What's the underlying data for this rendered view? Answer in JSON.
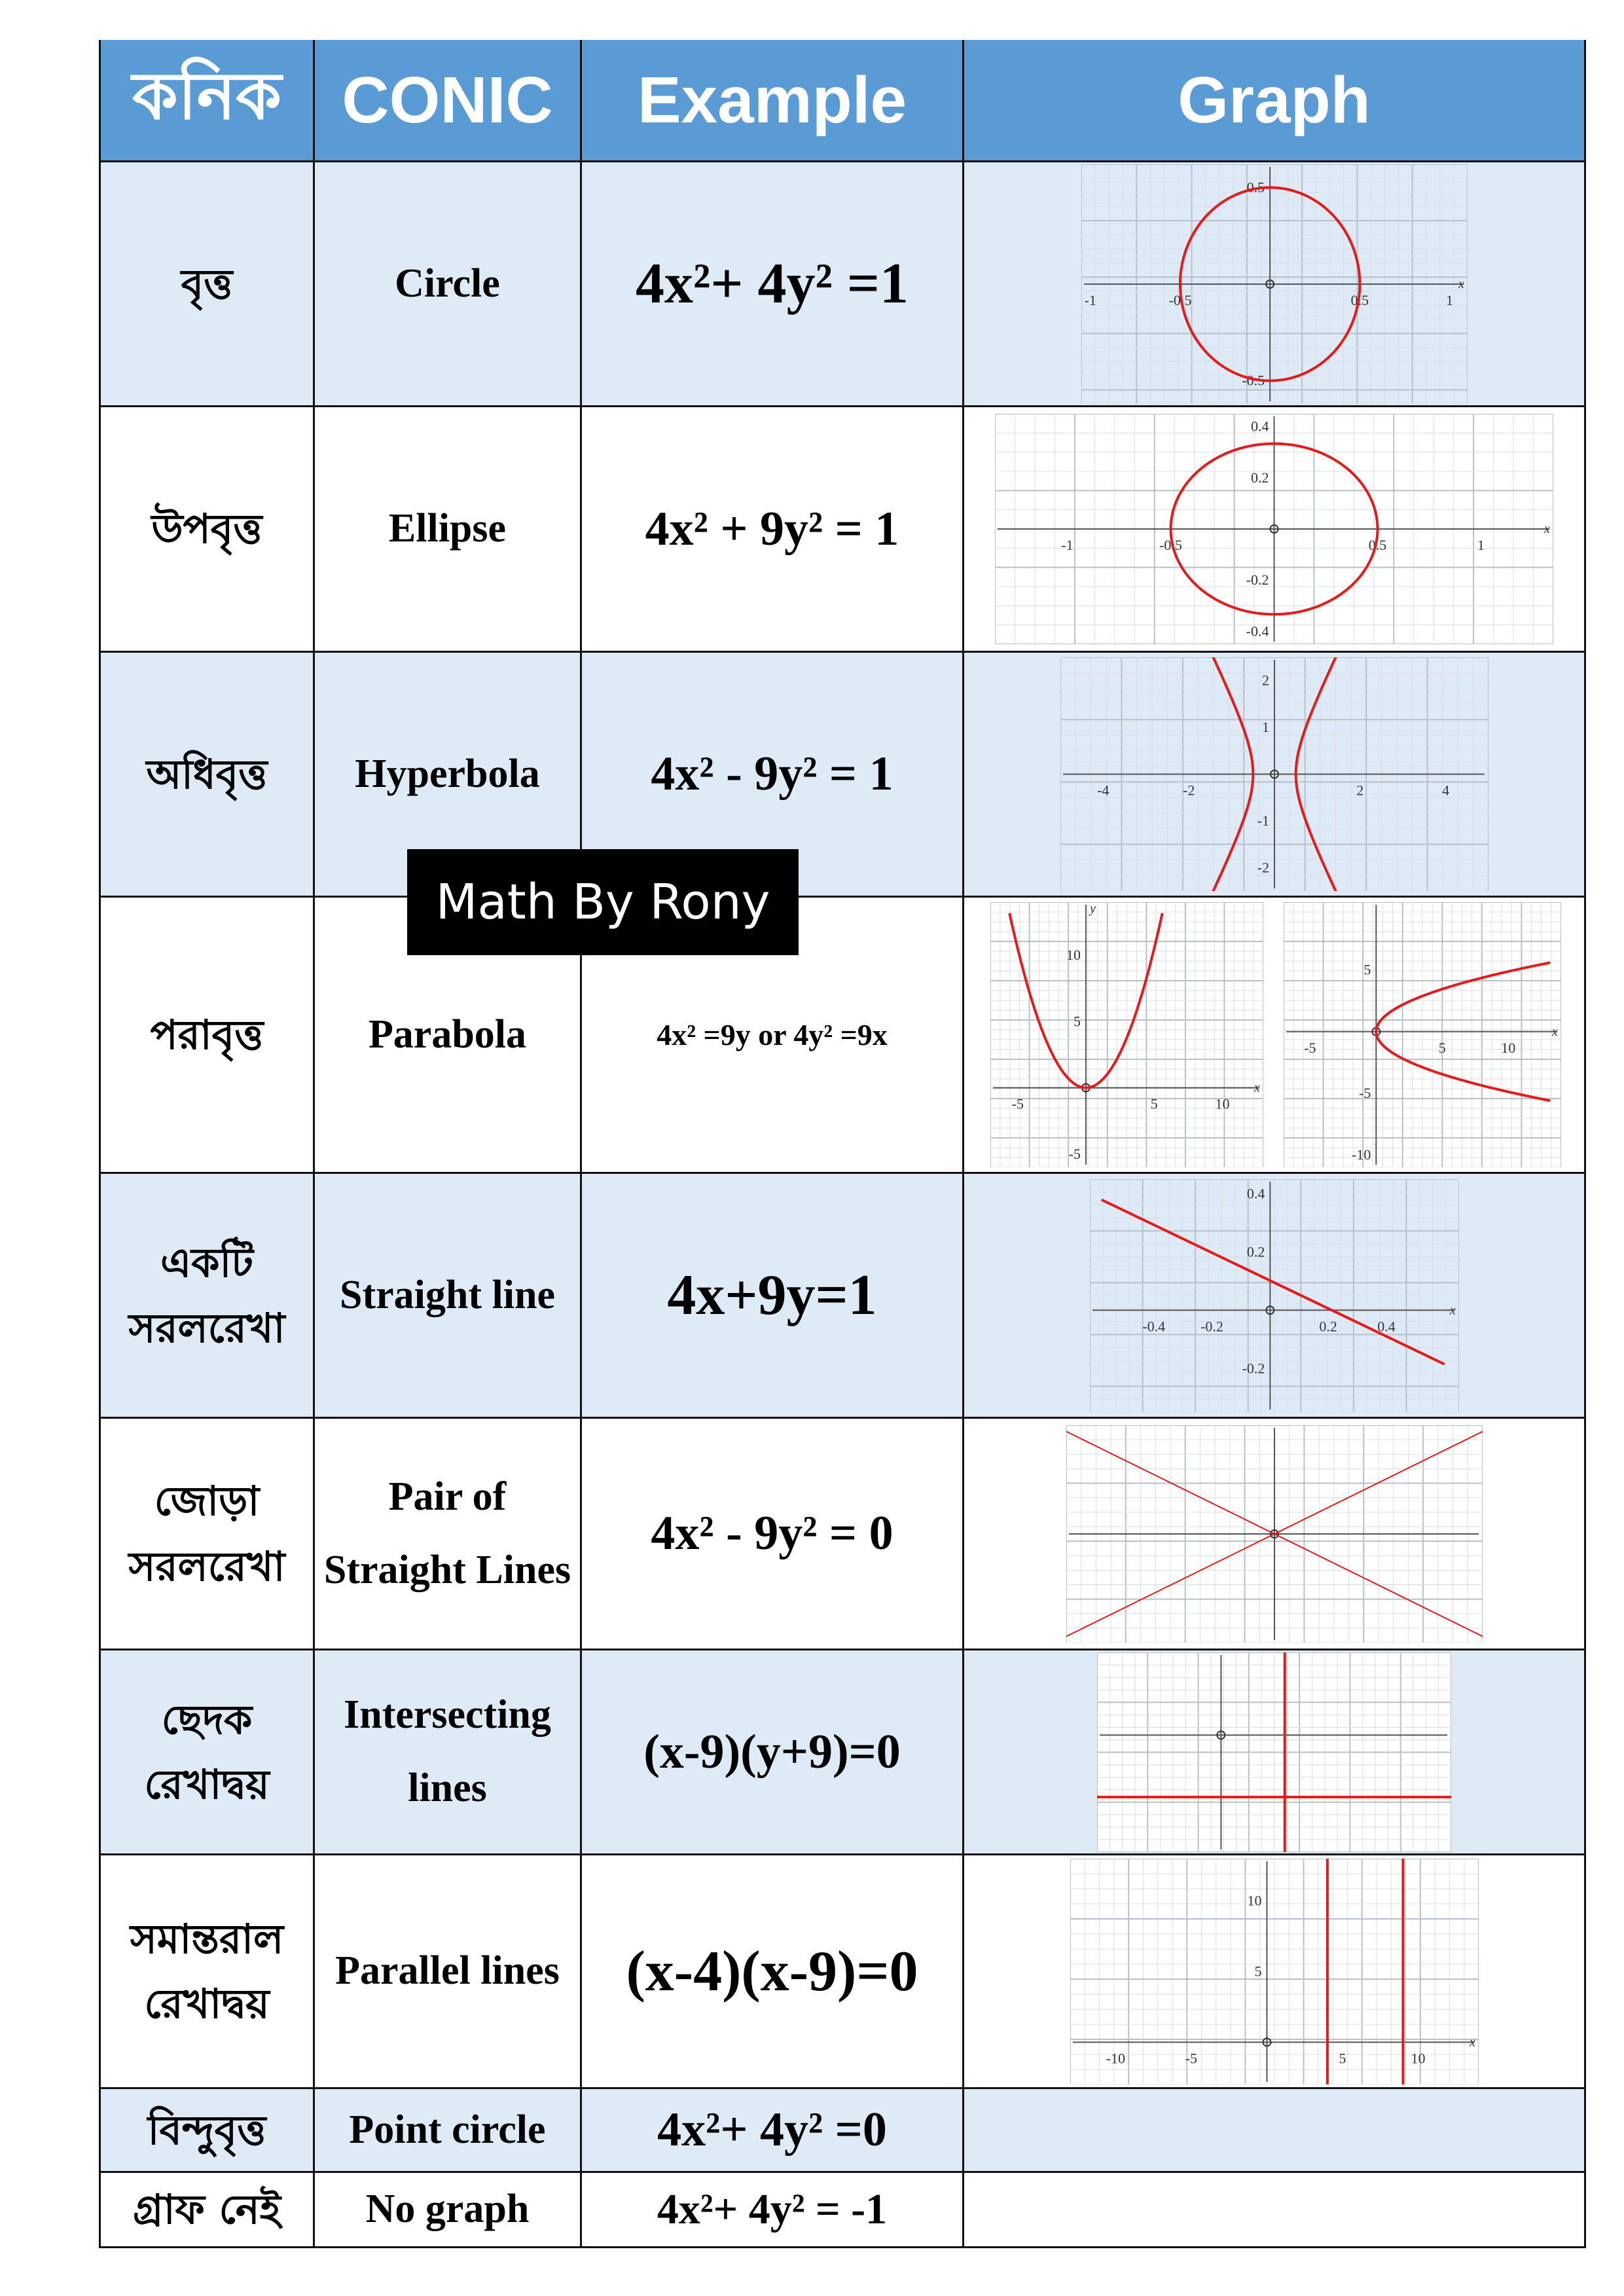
{
  "header": {
    "bengali": "কনিক",
    "conic": "CONIC",
    "example": "Example",
    "graph": "Graph",
    "color": "#5b9bd5"
  },
  "curve_color": "#e31b1b",
  "rows": [
    {
      "bengali": "বৃত্ত",
      "conic": "Circle",
      "equation": "4x²+ 4y² =1",
      "graph": {
        "kind": "circle",
        "xlim": [
          -1.05,
          1.1
        ],
        "ylim": [
          -0.62,
          0.62
        ],
        "xticks": [
          "-1",
          "-0.5",
          "0.5",
          "1"
        ],
        "yticks": [
          "0.5",
          "-0.5"
        ],
        "xlabel": "x"
      }
    },
    {
      "bengali": "উপবৃত্ত",
      "conic": "Ellipse",
      "equation": "4x² + 9y² = 1",
      "graph": {
        "kind": "ellipse",
        "xlim": [
          -1.35,
          1.35
        ],
        "ylim": [
          -0.45,
          0.45
        ],
        "xticks": [
          "-1",
          "-0.5",
          "0.5",
          "1"
        ],
        "yticks": [
          "0.4",
          "0.2",
          "-0.2",
          "-0.4"
        ],
        "xlabel": "x"
      }
    },
    {
      "bengali": "অধিবৃত্ত",
      "conic": "Hyperbola",
      "equation": "4x² - 9y² = 1",
      "graph": {
        "kind": "hyperbola",
        "xlim": [
          -5,
          5
        ],
        "ylim": [
          -2.5,
          2.5
        ],
        "xticks": [
          "-4",
          "-2",
          "2",
          "4"
        ],
        "yticks": [
          "2",
          "1",
          "-1",
          "-2"
        ],
        "xlabel": ""
      }
    },
    {
      "bengali": "পরাবৃত্ত",
      "conic": "Parabola",
      "equation": "4x² =9y  or  4y² =9x",
      "graph": {
        "kind": "parabola-up",
        "xlim": [
          -7,
          13
        ],
        "ylim": [
          -6,
          14
        ],
        "xticks": [
          "-5",
          "5",
          "10"
        ],
        "yticks": [
          "10",
          "5",
          "-5"
        ],
        "xlabel": "x",
        "ylabel": "y"
      },
      "graph2": {
        "kind": "parabola-right",
        "xlim": [
          -7,
          14
        ],
        "ylim": [
          -11,
          10.5
        ],
        "xticks": [
          "-5",
          "5",
          "10"
        ],
        "yticks": [
          "5",
          "-5",
          "-10"
        ],
        "xlabel": "x"
      }
    },
    {
      "bengali": "একটি সরলরেখা",
      "conic": "Straight line",
      "equation": "4x+9y=1",
      "graph": {
        "kind": "line",
        "xlim": [
          -0.62,
          0.65
        ],
        "ylim": [
          -0.35,
          0.45
        ],
        "xticks": [
          "-0.4",
          "-0.2",
          "0.2",
          "0.4"
        ],
        "yticks": [
          "0.4",
          "0.2",
          "-0.2"
        ],
        "xlabel": "x"
      }
    },
    {
      "bengali": "জোড়া সরলরেখা",
      "conic": "Pair of Straight Lines",
      "equation": "4x² - 9y² = 0",
      "graph": {
        "kind": "pair",
        "xlim": [
          -5,
          5
        ],
        "ylim": [
          -3.5,
          3.5
        ],
        "xticks": [],
        "yticks": [],
        "xlabel": ""
      }
    },
    {
      "bengali": "ছেদক রেখাদ্বয়",
      "conic": "Intersecting lines",
      "equation": "(x-9)(y+9)=0",
      "graph": {
        "kind": "intersecting",
        "xlim": [
          -17.5,
          32.5
        ],
        "ylim": [
          -17,
          12
        ],
        "xticks": [],
        "yticks": [],
        "xlabel": ""
      }
    },
    {
      "bengali": "সমান্তরাল রেখাদ্বয়",
      "conic": "Parallel lines",
      "equation": "(x-4)(x-9)=0",
      "graph": {
        "kind": "parallel",
        "xlim": [
          -13,
          14
        ],
        "ylim": [
          -3,
          13
        ],
        "xticks": [
          "-10",
          "-5",
          "5",
          "10"
        ],
        "yticks": [
          "10",
          "5"
        ],
        "xlabel": "x"
      }
    },
    {
      "bengali": "বিন্দুবৃত্ত",
      "conic": "Point circle",
      "equation": "4x²+ 4y² =0"
    },
    {
      "bengali": "গ্রাফ নেই",
      "conic": "No graph",
      "equation": "4x²+ 4y² = -1"
    }
  ],
  "watermark": "Math By Rony"
}
